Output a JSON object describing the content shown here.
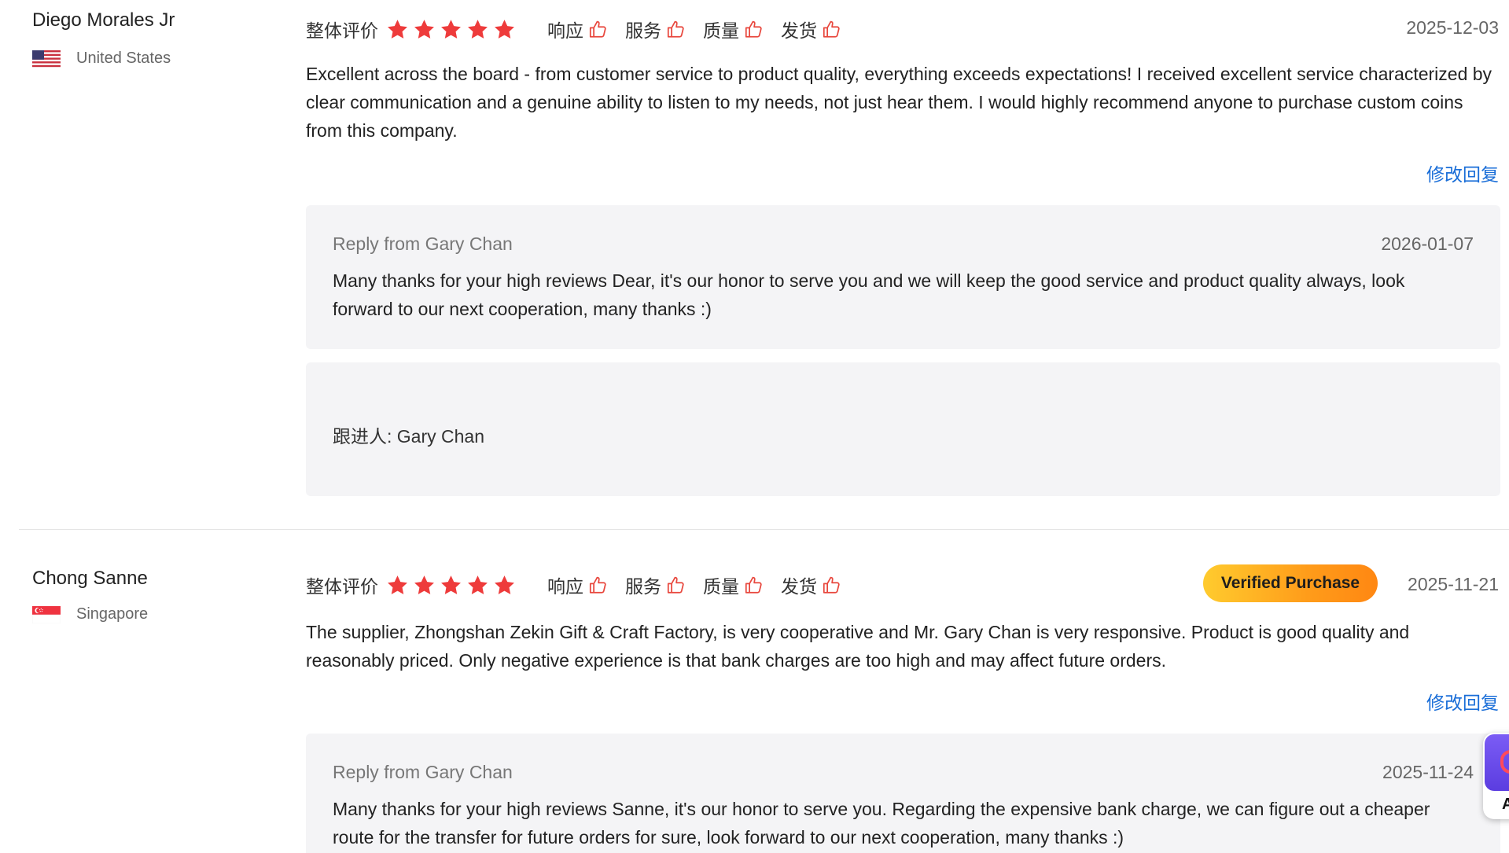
{
  "colors": {
    "star": "#ee3b3b",
    "thumb": "#e8473d",
    "link": "#1a6ed8",
    "badge_gradient": [
      "#ffcb2e",
      "#ff8712"
    ],
    "reply_bg": "#f4f4f6"
  },
  "rating_labels": {
    "overall": "整体评价",
    "response": "响应",
    "service": "服务",
    "quality": "质量",
    "shipping": "发货"
  },
  "reviews": [
    {
      "reviewer": "Diego Morales Jr",
      "country": "United States",
      "flag_icon": "us-flag-icon",
      "stars": 5,
      "date": "2025-12-03",
      "text": "Excellent across the board - from customer service to product quality, everything exceeds expectations! I received excellent service characterized by clear communication and a genuine ability to listen to my needs, not just hear them. I would highly recommend anyone to purchase custom coins from this company.",
      "edit_reply_label": "修改回复",
      "reply": {
        "from": "Reply from Gary Chan",
        "date": "2026-01-07",
        "text": "Many thanks for your high reviews Dear, it's our honor to serve you and we will keep the good service and product quality always, look forward to our next cooperation, many thanks :)"
      },
      "follow_up": "跟进人: Gary Chan"
    },
    {
      "reviewer": "Chong Sanne",
      "country": "Singapore",
      "flag_icon": "sg-flag-icon",
      "stars": 5,
      "badge": "Verified Purchase",
      "date": "2025-11-21",
      "text": "The supplier, Zhongshan Zekin Gift & Craft Factory, is very cooperative and Mr. Gary Chan is very responsive. Product is good quality and reasonably priced. Only negative experience is that bank charges are too high and may affect future orders.",
      "edit_reply_label": "修改回复",
      "reply": {
        "from": "Reply from Gary Chan",
        "date": "2025-11-24",
        "text": "Many thanks for your high reviews Sanne, it's our honor to serve you. Regarding the expensive bank charge, we can figure out a cheaper route for the transfer for future orders for sure, look forward to our next cooperation, many thanks :)"
      }
    }
  ],
  "floating_widget": {
    "label": "A",
    "icon": "assistant-icon"
  }
}
